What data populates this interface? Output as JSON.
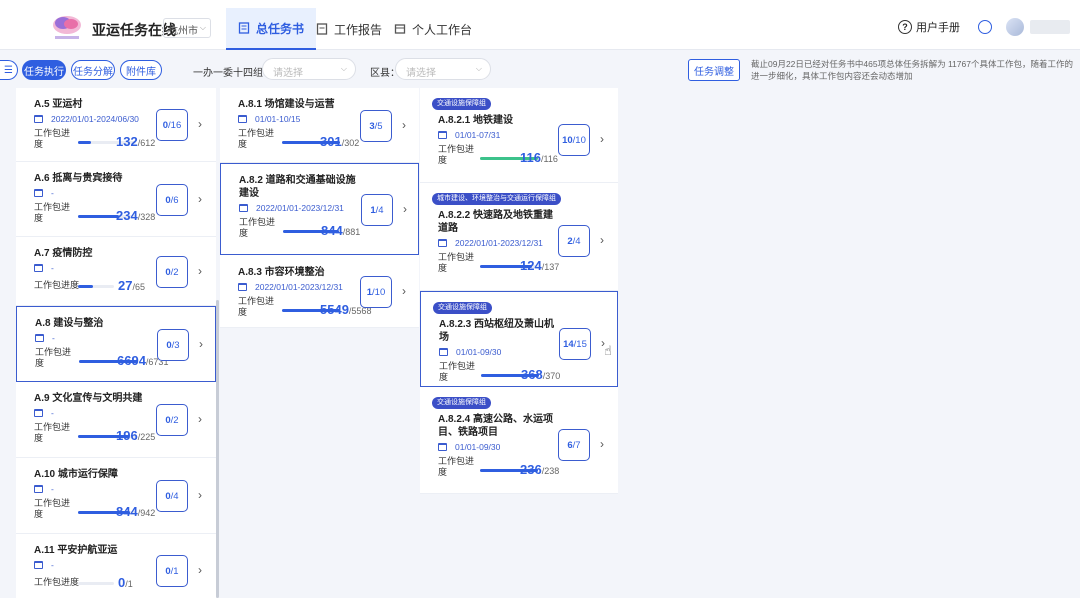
{
  "header": {
    "app_title": "亚运任务在线",
    "city": "杭州市",
    "tabs": [
      {
        "label": "总任务书",
        "active": true
      },
      {
        "label": "工作报告",
        "active": false
      },
      {
        "label": "个人工作台",
        "active": false
      }
    ],
    "help_label": "?",
    "manual_label": "用户手册"
  },
  "toolbar": {
    "pills": [
      "任务执行",
      "任务分解",
      "附件库"
    ],
    "group_label": "一办一委十四组：",
    "group_placeholder": "请选择",
    "district_label": "区县：",
    "district_placeholder": "请选择",
    "adjust_label": "任务调整",
    "notice": "截止09月22日已经对任务书中465项总体任务拆解为 11767个具体工作包，随着工作的进一步细化，具体工作包内容还会动态增加"
  },
  "col1": [
    {
      "title": "A.5 亚运村",
      "date": "2022/01/01-2024/06/30",
      "progress_label": "工作包进度",
      "done": "132",
      "total": "/612",
      "count_done": "0",
      "count_total": "/16"
    },
    {
      "title": "A.6 抵离与贵宾接待",
      "date": "-",
      "progress_label": "工作包进度",
      "done": "234",
      "total": "/328",
      "count_done": "0",
      "count_total": "/6"
    },
    {
      "title": "A.7 疫情防控",
      "date": "-",
      "progress_label": "工作包进度",
      "done": "27",
      "total": "/65",
      "count_done": "0",
      "count_total": "/2"
    },
    {
      "title": "A.8 建设与整治",
      "date": "-",
      "progress_label": "工作包进度",
      "done": "6694",
      "total": "/6731",
      "count_done": "0",
      "count_total": "/3"
    },
    {
      "title": "A.9 文化宣传与文明共建",
      "date": "-",
      "progress_label": "工作包进度",
      "done": "196",
      "total": "/225",
      "count_done": "0",
      "count_total": "/2"
    },
    {
      "title": "A.10 城市运行保障",
      "date": "-",
      "progress_label": "工作包进度",
      "done": "844",
      "total": "/942",
      "count_done": "0",
      "count_total": "/4"
    },
    {
      "title": "A.11 平安护航亚运",
      "date": "-",
      "progress_label": "工作包进度",
      "done": "0",
      "total": "/1",
      "count_done": "0",
      "count_total": "/1"
    }
  ],
  "col2": [
    {
      "title": "A.8.1 场馆建设与运营",
      "date": "01/01-10/15",
      "progress_label": "工作包进度",
      "done": "301",
      "total": "/302",
      "count_done": "3",
      "count_total": "/5"
    },
    {
      "title": "A.8.2 道路和交通基础设施建设",
      "date": "2022/01/01-2023/12/31",
      "progress_label": "工作包进度",
      "done": "844",
      "total": "/881",
      "count_done": "1",
      "count_total": "/4"
    },
    {
      "title": "A.8.3 市容环境整治",
      "date": "2022/01/01-2023/12/31",
      "progress_label": "工作包进度",
      "done": "5549",
      "total": "/5568",
      "count_done": "1",
      "count_total": "/10"
    }
  ],
  "col3": [
    {
      "tag": "交通设施保障组",
      "title": "A.8.2.1 地铁建设",
      "date": "01/01-07/31",
      "progress_label": "工作包进度",
      "done": "116",
      "total": "/116",
      "count_done": "10",
      "count_total": "/10"
    },
    {
      "tag": "城市建设、环境整治与交通运行保障组",
      "title": "A.8.2.2 快速路及地铁重建道路",
      "date": "2022/01/01-2023/12/31",
      "progress_label": "工作包进度",
      "done": "124",
      "total": "/137",
      "count_done": "2",
      "count_total": "/4"
    },
    {
      "tag": "交通设施保障组",
      "title": "A.8.2.3 西站枢纽及萧山机场",
      "date": "01/01-09/30",
      "progress_label": "工作包进度",
      "done": "368",
      "total": "/370",
      "count_done": "14",
      "count_total": "/15"
    },
    {
      "tag": "交通设施保障组",
      "title": "A.8.2.4 高速公路、水运项目、铁路项目",
      "date": "01/01-09/30",
      "progress_label": "工作包进度",
      "done": "236",
      "total": "/238",
      "count_done": "6",
      "count_total": "/7"
    }
  ],
  "colors": {
    "accent": "#2f5ee0",
    "green_progress": "#3cc28b",
    "tag_bg": "#3b4fc7"
  }
}
